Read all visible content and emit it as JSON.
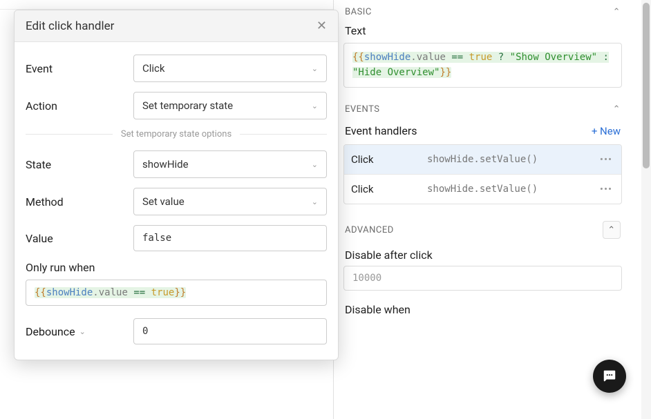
{
  "modal": {
    "title": "Edit click handler",
    "event_label": "Event",
    "event_value": "Click",
    "action_label": "Action",
    "action_value": "Set temporary state",
    "options_divider": "Set temporary state options",
    "state_label": "State",
    "state_value": "showHide",
    "method_label": "Method",
    "method_value": "Set value",
    "value_label": "Value",
    "value_value": "false",
    "run_when_label": "Only run when",
    "run_when_value": "{{showHide.value == true}}",
    "debounce_label": "Debounce",
    "debounce_value": "0"
  },
  "right": {
    "basic_heading": "BASIC",
    "text_label": "Text",
    "text_expr": "{{showHide.value == true ? \"Show Overview\" : \"Hide Overview\"}}",
    "events_heading": "EVENTS",
    "event_handlers_label": "Event handlers",
    "new_link": "+ New",
    "handlers": [
      {
        "event": "Click",
        "action": "showHide.setValue()"
      },
      {
        "event": "Click",
        "action": "showHide.setValue()"
      }
    ],
    "advanced_heading": "ADVANCED",
    "disable_after_label": "Disable after click",
    "disable_after_value": "10000",
    "disable_when_label": "Disable when"
  }
}
